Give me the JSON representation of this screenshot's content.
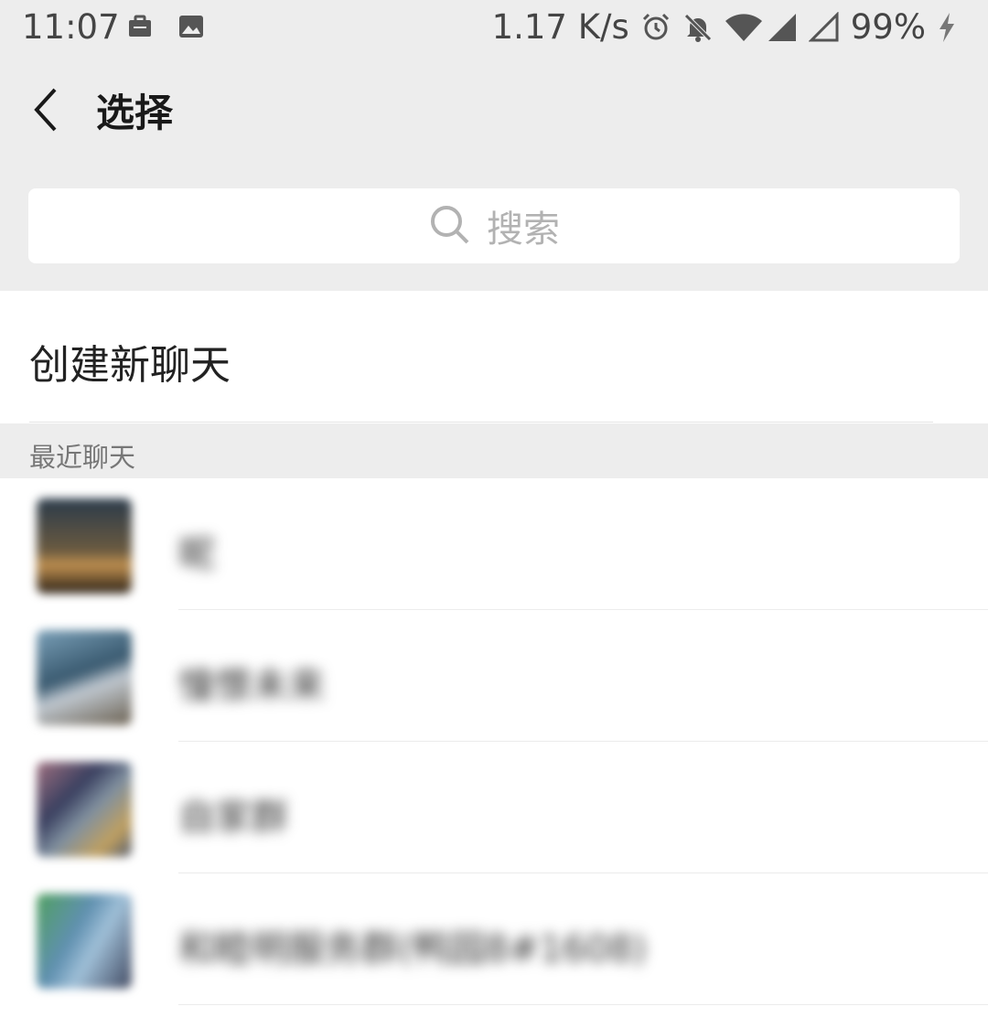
{
  "status_bar": {
    "time": "11:07",
    "net_speed": "1.17 K/s",
    "battery": "99%",
    "left_icons": [
      "briefcase-icon",
      "image-icon"
    ],
    "right_icons": [
      "alarm-icon",
      "bell-off-icon",
      "wifi-icon",
      "signal-icon",
      "signal-empty-icon",
      "charging-icon"
    ]
  },
  "header": {
    "title": "选择",
    "back_icon": "back-arrow-icon"
  },
  "search": {
    "placeholder": "搜索",
    "icon": "search-icon"
  },
  "new_chat": {
    "label": "创建新聊天"
  },
  "recent": {
    "section_label": "最近聊天",
    "chats": [
      {
        "name": "昵",
        "avatar_color": "#5a4a3a"
      },
      {
        "name": "憧憬未来",
        "avatar_color": "#6a8090"
      },
      {
        "name": "自家群",
        "avatar_color": "#7a7a8a"
      },
      {
        "name": "和睦明服务群(鸭园8#1608)",
        "avatar_color": "#5e7a70"
      }
    ]
  },
  "colors": {
    "header_bg": "#ededed",
    "text_primary": "#191919",
    "placeholder": "#b2b2b2"
  }
}
